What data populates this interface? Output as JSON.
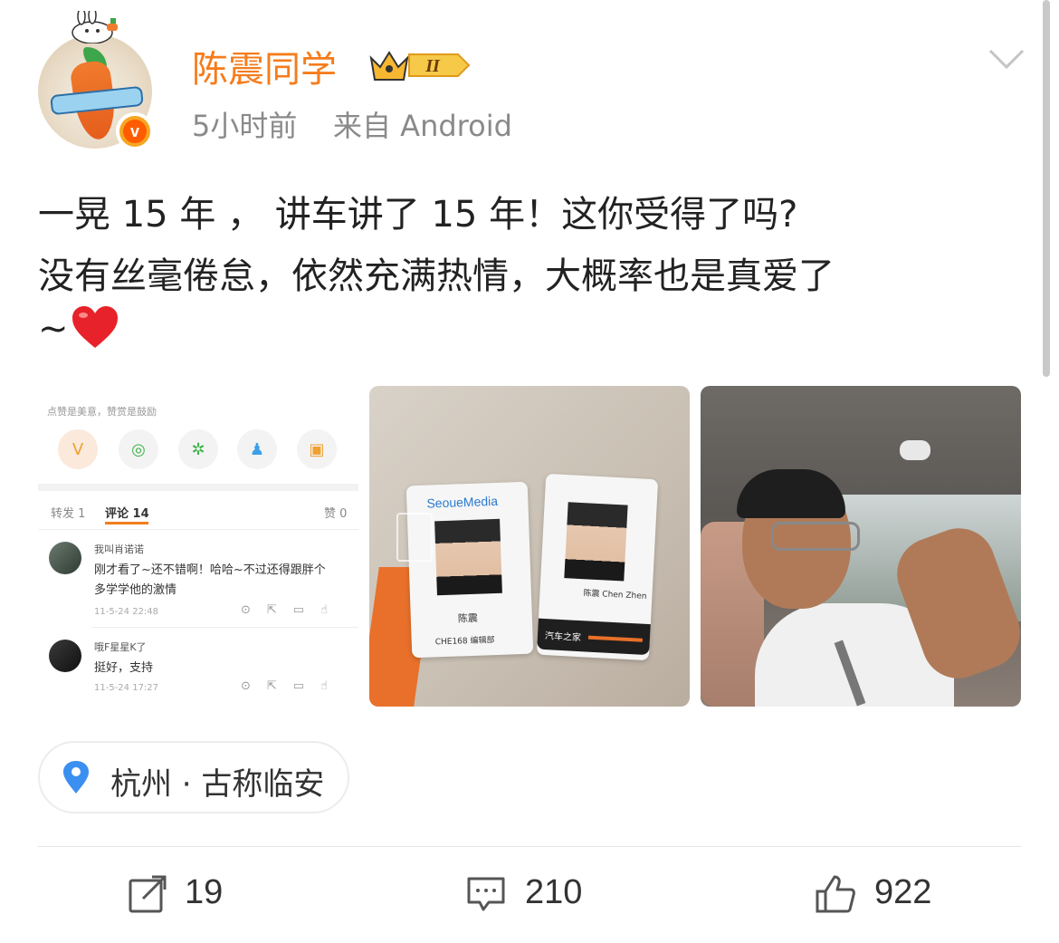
{
  "post": {
    "username": "陈震同学",
    "level_badge": "II",
    "time": "5小时前",
    "source": "来自 Android",
    "text_lines": [
      "一晃 15 年 ， 讲车讲了 15 年！这你受得了吗?",
      "没有丝毫倦怠，依然充满热情，大概率也是真爱了",
      "~"
    ],
    "location": "杭州 · 古称临安"
  },
  "screenshot_image": {
    "hint": "点赞是美意，赞赏是鼓励",
    "tabs": {
      "repost": "转发 1",
      "comments": "评论 14",
      "likes": "赞 0"
    },
    "comments": [
      {
        "name": "我叫肖诺诺",
        "text_line1": "刚才看了~还不错啊！哈哈~不过还得跟胖个",
        "text_line2": "多学学他的激情",
        "date": "11-5-24 22:48"
      },
      {
        "name": "哦F星星K了",
        "text_line1": "挺好，支持",
        "text_line2": "",
        "date": "11-5-24 17:27"
      }
    ]
  },
  "badge_cards": {
    "card1_brand": "SeoueMedia",
    "card1_name": "陈震",
    "card1_footer": "CHE168 编辑部",
    "card2_name": "陈震 Chen Zhen",
    "card2_footer": "汽车之家"
  },
  "actions": {
    "repost_count": "19",
    "comment_count": "210",
    "like_count": "922"
  },
  "colors": {
    "username": "#f57c1c",
    "meta": "#8a8a8a",
    "verified": "#ff5b00"
  }
}
